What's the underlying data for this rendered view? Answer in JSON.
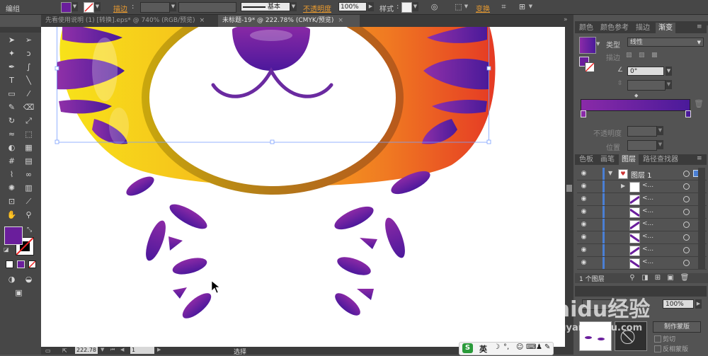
{
  "control_bar": {
    "selection_type": "编组",
    "stroke_label": "描边",
    "stroke_style": "基本",
    "opacity_label": "不透明度",
    "opacity_value": "100%",
    "style_label": "样式",
    "transform_label": "变换",
    "fill_color": "#6a1e9c"
  },
  "tabs": [
    {
      "label": "先看使用说明 (1) [转换].eps* @ 740% (RGB/预览)",
      "close": "×"
    },
    {
      "label": "未标题-19* @ 222.78% (CMYK/预览)",
      "close": "×"
    }
  ],
  "status_bar": {
    "zoom": "222.78",
    "page": "1",
    "tool_status": "选择"
  },
  "panel_top": {
    "tabs": [
      "颜色",
      "颜色参考",
      "描边",
      "渐变"
    ],
    "type_label": "类型",
    "type_value": "线性",
    "stroke_label": "描边",
    "angle_value": "0°",
    "opacity_label": "不透明度",
    "position_label": "位置",
    "gradient_start": "#8a2aa8",
    "gradient_end": "#4a1a9a"
  },
  "panel_layers": {
    "tabs": [
      "色板",
      "画笔",
      "图层",
      "路径查找器"
    ],
    "layer_name": "图层 1",
    "sublayer_label": "<...",
    "footer": "1 个图层"
  },
  "panel_bottom": {
    "opacity_value": "100%",
    "mask_button": "制作蒙版",
    "clip_label": "剪切",
    "invert_label": "反相蒙版"
  },
  "ime_bar": {
    "logo": "S",
    "lang": "英"
  },
  "watermark": {
    "brand": "Baidu经验",
    "url": "jingyan.baidu.com"
  }
}
